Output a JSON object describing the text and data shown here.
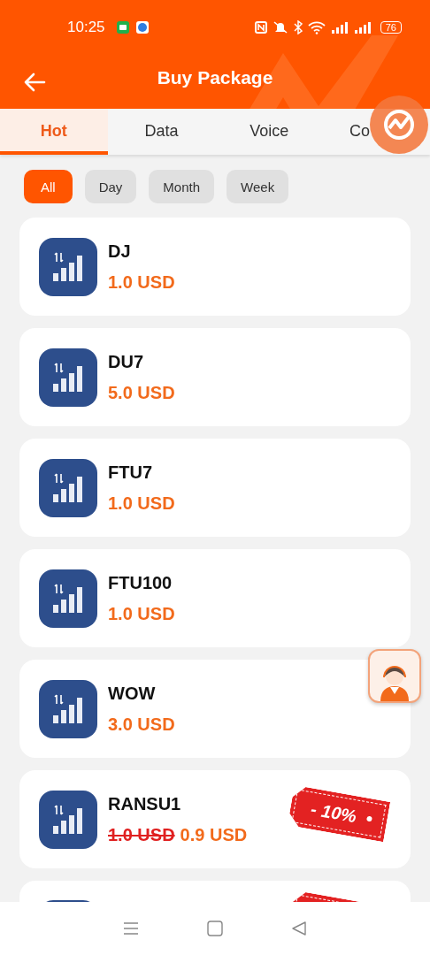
{
  "status_bar": {
    "time": "10:25",
    "battery": "76"
  },
  "header": {
    "title": "Buy Package"
  },
  "tabs": [
    {
      "label": "Hot",
      "selected": true
    },
    {
      "label": "Data",
      "selected": false
    },
    {
      "label": "Voice",
      "selected": false
    },
    {
      "label": "Co",
      "selected": false
    }
  ],
  "filters": [
    {
      "label": "All",
      "selected": true
    },
    {
      "label": "Day",
      "selected": false
    },
    {
      "label": "Month",
      "selected": false
    },
    {
      "label": "Week",
      "selected": false
    }
  ],
  "packages": [
    {
      "kind": "full",
      "name": "DJ",
      "price": "1.0 USD"
    },
    {
      "kind": "full",
      "name": "DU7",
      "price": "5.0 USD"
    },
    {
      "kind": "full",
      "name": "FTU7",
      "price": "1.0 USD"
    },
    {
      "kind": "full",
      "name": "FTU100",
      "price": "1.0 USD"
    },
    {
      "kind": "full",
      "name": "WOW",
      "price": "3.0 USD"
    },
    {
      "kind": "full",
      "name": "RANSU1",
      "old_price": "1.0 USD",
      "price": "0.9 USD",
      "discount": "- 10%"
    },
    {
      "kind": "partial"
    }
  ]
}
